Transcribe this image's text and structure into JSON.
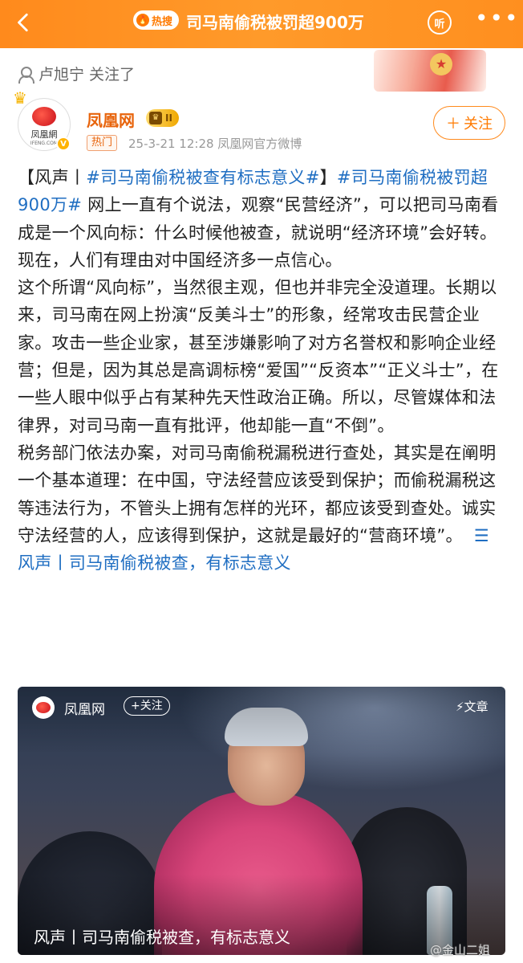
{
  "header": {
    "hot_label": "热搜",
    "title": "司马南偷税被罚超900万",
    "listen_label": "听",
    "more_label": "•••"
  },
  "post": {
    "followed_notice": "卢旭宁 关注了",
    "author": "凤凰网",
    "vip_level": "II",
    "hot_tag": "热门",
    "meta": "25-3-21 12:28  凤凰网官方微博",
    "follow_label": "关注",
    "avatar_cn": "凤凰網",
    "avatar_en": "IFENG.COM",
    "body": {
      "p1_prefix": "【风声丨",
      "p1_topic1": "#司马南偷税被查有标志意义#",
      "p1_mid": "】",
      "p1_topic2": "#司马南偷税被罚超900万#",
      "p1_rest": " 网上一直有个说法，观察“民营经济”，可以把司马南看成是一个风向标：什么时候他被查，就说明“经济环境”会好转。现在，人们有理由对中国经济多一点信心。",
      "p2": "这个所谓“风向标”，当然很主观，但也并非完全没道理。长期以来，司马南在网上扮演“反美斗士”的形象，经常攻击民营企业家。攻击一些企业家，甚至涉嫌影响了对方名誉权和影响企业经营；但是，因为其总是高调标榜“爱国”“反资本”“正义斗士”，在一些人眼中似乎占有某种先天性政治正确。所以，尽管媒体和法律界，对司马南一直有批评，他却能一直“不倒”。",
      "p3": "税务部门依法办案，对司马南偷税漏税进行查处，其实是在阐明一个基本道理：在中国，守法经营应该受到保护；而偷税漏税这等违法行为，不管头上拥有怎样的光环，都应该受到查处。诚实守法经营的人，应该得到保护，这就是最好的“营商环境”。",
      "p3_link": "风声丨司马南偷税被查，有标志意义"
    }
  },
  "article_card": {
    "source": "凤凰网",
    "follow_label": "+关注",
    "type_label": "⚡文章",
    "title": "风声丨司马南偷税被查，有标志意义"
  },
  "watermark": "@金山二姐",
  "colors": {
    "header_orange": "#ff8a1c",
    "topic_blue": "#1f6ec2",
    "author_orange": "#e8640c"
  }
}
